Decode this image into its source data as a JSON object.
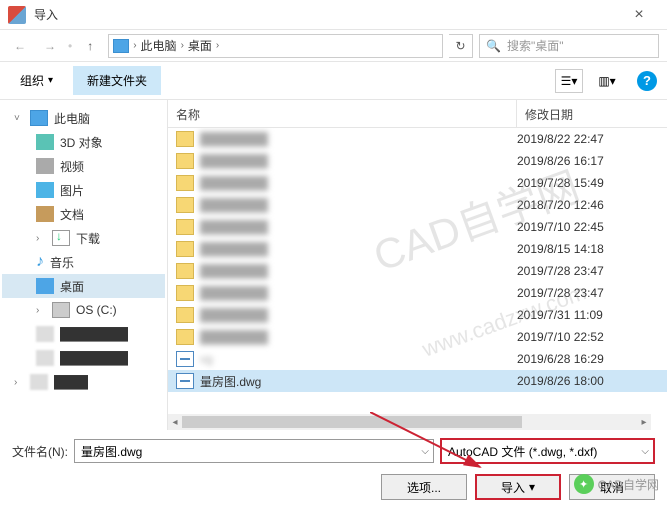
{
  "window": {
    "title": "导入"
  },
  "nav": {
    "crumb1": "此电脑",
    "crumb2": "桌面",
    "search_placeholder": "搜索\"桌面\""
  },
  "toolbar": {
    "organize": "组织",
    "new_folder": "新建文件夹"
  },
  "sidebar": {
    "this_pc": "此电脑",
    "obj3d": "3D 对象",
    "videos": "视频",
    "pictures": "图片",
    "docs": "文档",
    "downloads": "下载",
    "music": "音乐",
    "desktop": "桌面",
    "osc": "OS (C:)"
  },
  "columns": {
    "name": "名称",
    "date": "修改日期"
  },
  "files": [
    {
      "name": "",
      "date": "2019/8/22 22:47",
      "type": "folder",
      "blur": true
    },
    {
      "name": "",
      "date": "2019/8/26 16:17",
      "type": "folder",
      "blur": true
    },
    {
      "name": "",
      "date": "2019/7/28 15:49",
      "type": "folder",
      "blur": true
    },
    {
      "name": "",
      "date": "2018/7/20 12:46",
      "type": "folder",
      "blur": true
    },
    {
      "name": "",
      "date": "2019/7/10 22:45",
      "type": "folder",
      "blur": true
    },
    {
      "name": "",
      "date": "2019/8/15 14:18",
      "type": "folder",
      "blur": true
    },
    {
      "name": "",
      "date": "2019/7/28 23:47",
      "type": "folder",
      "blur": true
    },
    {
      "name": "",
      "date": "2019/7/28 23:47",
      "type": "folder",
      "blur": true
    },
    {
      "name": "",
      "date": "2019/7/31 11:09",
      "type": "folder",
      "blur": true
    },
    {
      "name": "",
      "date": "2019/7/10 22:52",
      "type": "folder",
      "blur": true
    },
    {
      "name": "vg",
      "date": "2019/6/28 16:29",
      "type": "dwg",
      "blur": true
    },
    {
      "name": "量房图.dwg",
      "date": "2019/8/26 18:00",
      "type": "dwg",
      "blur": false,
      "selected": true
    }
  ],
  "bottom": {
    "filename_label": "文件名(N):",
    "filename_value": "量房图.dwg",
    "filetype_value": "AutoCAD 文件 (*.dwg, *.dxf)",
    "options_btn": "选项...",
    "import_btn": "导入",
    "cancel_btn": "取消"
  },
  "watermark": {
    "main": "CAD自学网",
    "url": "www.cadzxw.com"
  },
  "wechat": "CAD自学网"
}
